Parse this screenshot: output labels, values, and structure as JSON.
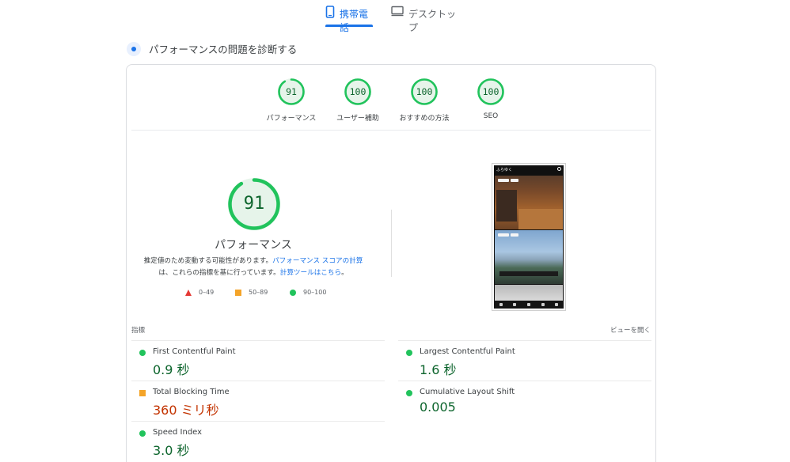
{
  "tabs": [
    {
      "label": "携帯電話",
      "icon": "smartphone-icon",
      "active": true
    },
    {
      "label": "デスクトップ",
      "icon": "desktop-icon",
      "active": false
    }
  ],
  "section": {
    "title": "パフォーマンスの問題を診断する"
  },
  "colors": {
    "accent": "#1a73e8",
    "pass": "#0cce6b",
    "average": "#ffa400",
    "fail": "#ff4e42"
  },
  "summary_scores": [
    {
      "label": "パフォーマンス",
      "score": "91"
    },
    {
      "label": "ユーザー補助",
      "score": "100"
    },
    {
      "label": "おすすめの方法",
      "score": "100"
    },
    {
      "label": "SEO",
      "score": "100"
    }
  ],
  "performance": {
    "score": "91",
    "label": "パフォーマンス",
    "note_part1": "推定値のため変動する可能性があります。",
    "note_link1": "パフォーマンス スコアの計算",
    "note_part2": "は、これらの指標を基に行っています。",
    "note_link2": "計算ツールはこちら",
    "note_end": "。"
  },
  "legend": [
    {
      "shape": "triangle",
      "range": "0–49"
    },
    {
      "shape": "square",
      "range": "50–89"
    },
    {
      "shape": "circle",
      "range": "90–100"
    }
  ],
  "screenshot": {
    "brand": "ふらゆく"
  },
  "metrics": {
    "header": "指標",
    "toggle": "ビューを開く",
    "items": [
      {
        "name": "First Contentful Paint",
        "value": "0.9 秒",
        "status": "pass"
      },
      {
        "name": "Largest Contentful Paint",
        "value": "1.6 秒",
        "status": "pass"
      },
      {
        "name": "Total Blocking Time",
        "value": "360 ミリ秒",
        "status": "average"
      },
      {
        "name": "Cumulative Layout Shift",
        "value": "0.005",
        "status": "pass"
      },
      {
        "name": "Speed Index",
        "value": "3.0 秒",
        "status": "pass"
      }
    ]
  }
}
